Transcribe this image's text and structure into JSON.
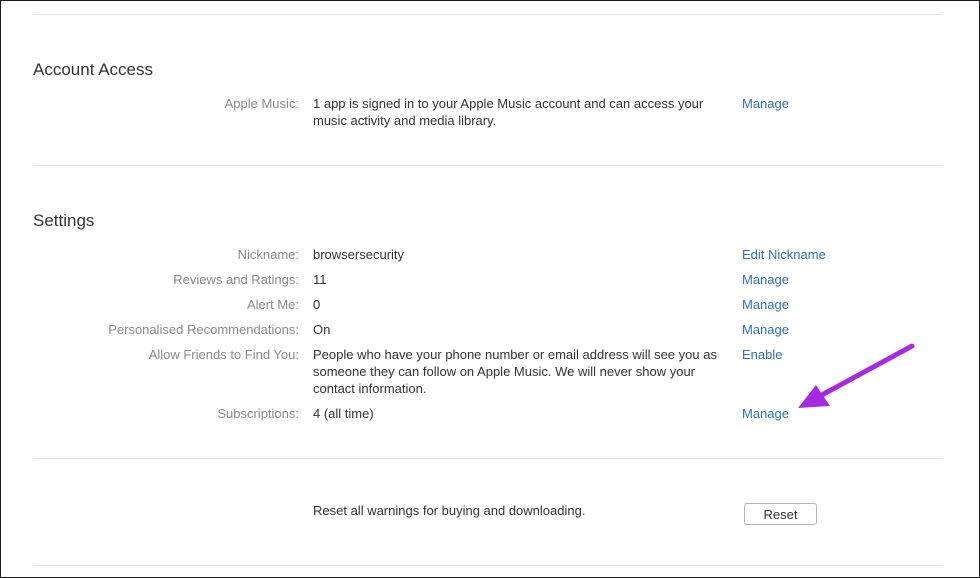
{
  "account_access": {
    "title": "Account Access",
    "rows": [
      {
        "label": "Apple Music:",
        "value": "1 app is signed in to your Apple Music account and can access your music activity and media library.",
        "action": "Manage"
      }
    ]
  },
  "settings": {
    "title": "Settings",
    "rows": [
      {
        "label": "Nickname:",
        "value": "browsersecurity",
        "action": "Edit Nickname"
      },
      {
        "label": "Reviews and Ratings:",
        "value": "11",
        "action": "Manage"
      },
      {
        "label": "Alert Me:",
        "value": "0",
        "action": "Manage"
      },
      {
        "label": "Personalised Recommendations:",
        "value": "On",
        "action": "Manage"
      },
      {
        "label": "Allow Friends to Find You:",
        "value": "People who have your phone number or email address will see you as someone they can follow on Apple Music. We will never show your contact information.",
        "action": "Enable"
      },
      {
        "label": "Subscriptions:",
        "value": "4 (all time)",
        "action": "Manage"
      }
    ]
  },
  "reset_section": {
    "text": "Reset all warnings for buying and downloading.",
    "button_label": "Reset"
  },
  "colors": {
    "link": "#2f6fb5",
    "label": "#8a8a8a",
    "arrow": "#a52ae0"
  },
  "annotation": {
    "icon": "purple-arrow-icon",
    "points_to": "Subscriptions Manage"
  }
}
